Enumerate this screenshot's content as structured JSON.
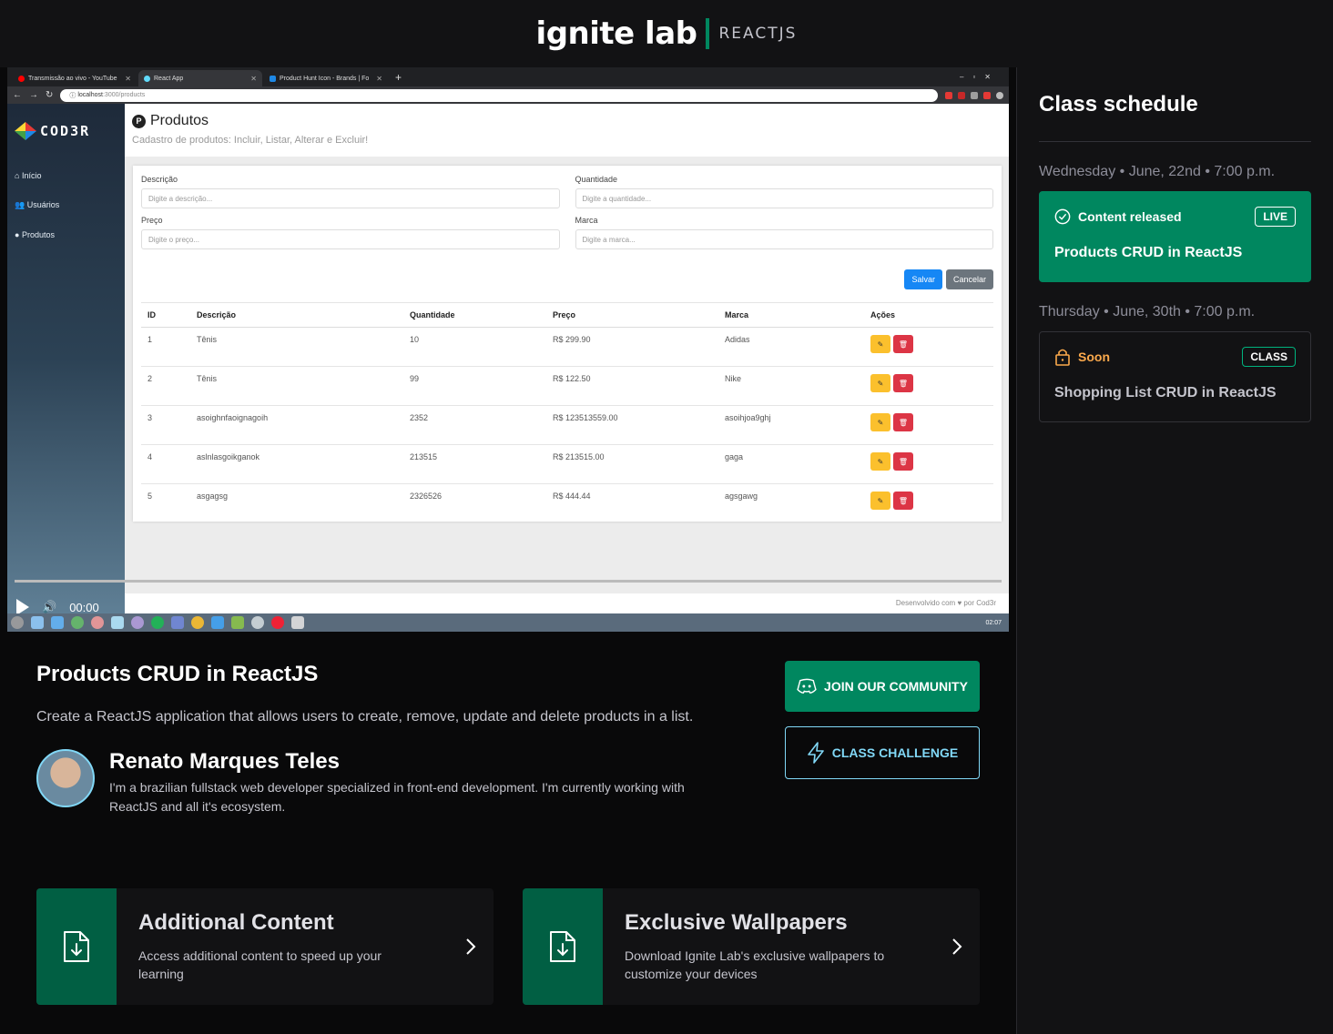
{
  "header": {
    "brand": "ignite lab",
    "track": "REACTJS"
  },
  "sidebar": {
    "title": "Class schedule",
    "lessons": [
      {
        "date": "Wednesday • June, 22nd • 7:00 p.m.",
        "status": "Content released",
        "tag": "LIVE",
        "title": "Products CRUD in ReactJS"
      },
      {
        "date": "Thursday • June, 30th • 7:00 p.m.",
        "status": "Soon",
        "tag": "CLASS",
        "title": "Shopping List CRUD in ReactJS"
      }
    ]
  },
  "video": {
    "browser": {
      "tabs": [
        "Transmissão ao vivo - YouTube",
        "React App",
        "Product Hunt Icon - Brands | Fo"
      ],
      "url_host": "localhost",
      "url_path": ":3000/products"
    },
    "app": {
      "logo": "COD3R",
      "nav": [
        "Início",
        "Usuários",
        "Produtos"
      ],
      "title": "Produtos",
      "title_icon": "P",
      "subtitle": "Cadastro de produtos: Incluir, Listar, Alterar e Excluir!",
      "fields": [
        {
          "label": "Descrição",
          "placeholder": "Digite a descrição..."
        },
        {
          "label": "Quantidade",
          "placeholder": "Digite a quantidade..."
        },
        {
          "label": "Preço",
          "placeholder": "Digite o preço..."
        },
        {
          "label": "Marca",
          "placeholder": "Digite a marca..."
        }
      ],
      "save_label": "Salvar",
      "cancel_label": "Cancelar",
      "table": {
        "headers": [
          "ID",
          "Descrição",
          "Quantidade",
          "Preço",
          "Marca",
          "Ações"
        ],
        "rows": [
          [
            "1",
            "Tênis",
            "10",
            "R$ 299.90",
            "Adidas"
          ],
          [
            "2",
            "Tênis",
            "99",
            "R$ 122.50",
            "Nike"
          ],
          [
            "3",
            "asoighnfaoignagoih",
            "2352",
            "R$ 123513559.00",
            "asoihjoa9ghj"
          ],
          [
            "4",
            "aslnlasgoikganok",
            "213515",
            "R$ 213515.00",
            "gaga"
          ],
          [
            "5",
            "asgagsg",
            "2326526",
            "R$ 444.44",
            "agsgawg"
          ]
        ]
      },
      "footer": "Desenvolvido com ♥ por Cod3r"
    },
    "player_time": "00:00",
    "taskbar_time": "02:07"
  },
  "lesson": {
    "title": "Products CRUD in ReactJS",
    "description": "Create a ReactJS application that allows users to create, remove, update and delete products in a list.",
    "teacher_name": "Renato Marques Teles",
    "teacher_bio": "I'm a brazilian fullstack web developer specialized in front-end development. I'm currently working with ReactJS and all it's ecosystem."
  },
  "actions": {
    "community": "JOIN OUR COMMUNITY",
    "challenge": "CLASS CHALLENGE"
  },
  "resources": [
    {
      "title": "Additional Content",
      "description": "Access additional content to speed up your learning"
    },
    {
      "title": "Exclusive Wallpapers",
      "description": "Download Ignite Lab's exclusive wallpapers to customize your devices"
    }
  ],
  "colors": {
    "green": "#00875f",
    "dark_green": "#015f43",
    "blue": "#81d8f7",
    "orange": "#fba94c"
  }
}
